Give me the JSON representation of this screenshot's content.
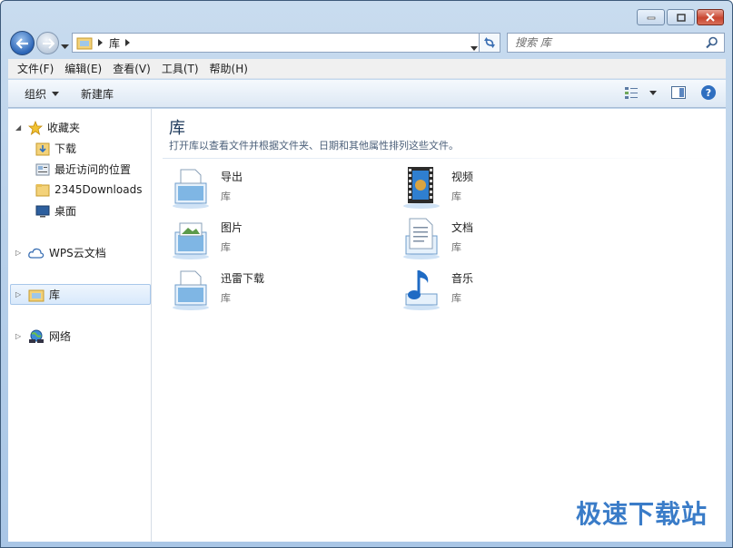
{
  "window": {
    "minimize_icon": "minimize-icon",
    "maximize_icon": "maximize-icon",
    "close_icon": "close-icon"
  },
  "navbar": {
    "breadcrumb": [
      "库"
    ],
    "search_placeholder": "搜索 库"
  },
  "menubar": {
    "items": [
      "文件(F)",
      "编辑(E)",
      "查看(V)",
      "工具(T)",
      "帮助(H)"
    ]
  },
  "toolbar": {
    "organize_label": "组织",
    "new_library_label": "新建库"
  },
  "sidebar": {
    "favorites": {
      "label": "收藏夹",
      "items": [
        "下载",
        "最近访问的位置",
        "2345Downloads",
        "桌面"
      ]
    },
    "wps_cloud": "WPS云文档",
    "libraries": "库",
    "network": "网络"
  },
  "main": {
    "title": "库",
    "subtitle": "打开库以查看文件并根据文件夹、日期和其他属性排列这些文件。",
    "libraries": [
      {
        "name": "导出",
        "type": "库",
        "icon": "document-library-icon"
      },
      {
        "name": "视频",
        "type": "库",
        "icon": "video-library-icon"
      },
      {
        "name": "图片",
        "type": "库",
        "icon": "pictures-library-icon"
      },
      {
        "name": "文档",
        "type": "库",
        "icon": "documents-library-icon"
      },
      {
        "name": "迅雷下载",
        "type": "库",
        "icon": "document-library-icon"
      },
      {
        "name": "音乐",
        "type": "库",
        "icon": "music-library-icon"
      }
    ]
  },
  "watermark": "极速下载站",
  "colors": {
    "frame": "#b9d1ea",
    "title_text": "#1e395b",
    "selection": "#d9e9fb",
    "watermark": "#3a7cc8"
  }
}
